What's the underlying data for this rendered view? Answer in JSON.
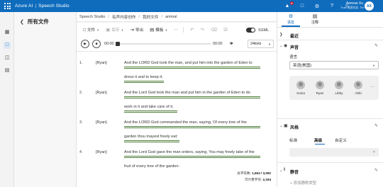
{
  "topbar": {
    "product": "Azure AI",
    "separator": "|",
    "app": "Speech Studio",
    "notification_count": "8",
    "user_name": "Aemow Xu",
    "user_region": "Trust·美国东部, TW",
    "avatar_initials": "AX",
    "accent": "#0f6cbd"
  },
  "files_panel": {
    "title": "所有文件"
  },
  "breadcrumb": [
    "Speech Studio",
    "有声内容创作",
    "我的文件",
    "animal"
  ],
  "toolbar": {
    "file": "文件",
    "save": "保存",
    "export": "导出",
    "template": "模板",
    "ssml": "SSML"
  },
  "player": {
    "time_start": "00:00",
    "time_end": "00:00",
    "sample_rate": "24kHz"
  },
  "paragraphs": [
    {
      "num": "1.",
      "voice": "[Ryan]",
      "lines": [
        "And the LORD God took the man, and put him into the garden of Eden to",
        "dress it and to keep it."
      ]
    },
    {
      "num": "2.",
      "voice": "[Ryan]",
      "lines": [
        "And the Lord God took the man and put him in the garden of Eden to do",
        "work in it and take care of it."
      ]
    },
    {
      "num": "3.",
      "voice": "[Ryan]",
      "lines": [
        "And the LORD God commanded the man, saying, Of every tree of the",
        "garden thou mayest freely eat:"
      ]
    },
    {
      "num": "4.",
      "voice": "[Ryan]",
      "lines": [
        "And the Lord God gave the man orders, saying, You may freely take of the",
        "fruit of every tree of the garden:"
      ]
    }
  ],
  "counts": {
    "total_label": "总字符数:",
    "total_value": "1,653 / 3,000",
    "billable_label": "可计费字符:",
    "billable_value": "2,194"
  },
  "right_panel": {
    "tab_voice": "语音",
    "tab_notes": "注释",
    "recent": "最近",
    "voice_section": "声音",
    "language_label": "语言",
    "language_value": "英语(美国)",
    "voices": [
      "Sonia",
      "Ryan",
      "Libby",
      "Abbi"
    ],
    "style_section": "风格",
    "style_tabs": [
      "标准",
      "高级",
      "自定义"
    ],
    "pause_section": "静音",
    "add_pause": "添加静默类型"
  }
}
